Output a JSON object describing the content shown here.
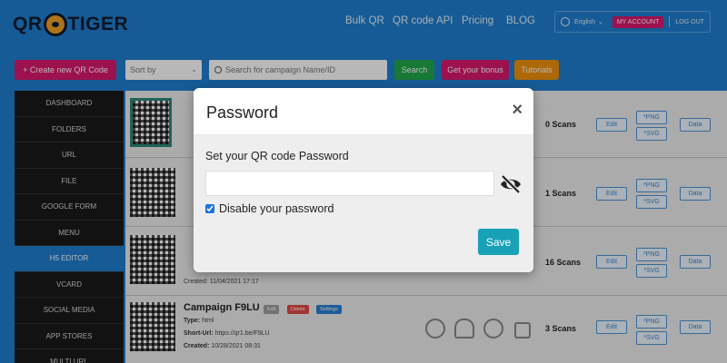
{
  "brand": {
    "logo_left": "QR",
    "logo_right": "TIGER"
  },
  "nav": {
    "bulk_qr": "Bulk QR",
    "qr_api": "QR code API",
    "pricing": "Pricing",
    "blog": "BLOG"
  },
  "account": {
    "language": "English",
    "my_account": "MY ACCOUNT",
    "logout": "LOG OUT"
  },
  "toolbar": {
    "create_label": "+ Create new QR Code",
    "sort_placeholder": "Sort by",
    "search_placeholder": "Search for campaign Name/ID",
    "search_label": "Search",
    "bonus_label": "Get your bonus",
    "tutorials_label": "Tutorials"
  },
  "sidebar": {
    "items": [
      {
        "label": "DASHBOARD"
      },
      {
        "label": "FOLDERS"
      },
      {
        "label": "URL"
      },
      {
        "label": "FILE"
      },
      {
        "label": "GOOGLE FORM"
      },
      {
        "label": "MENU"
      },
      {
        "label": "H5 EDITOR"
      },
      {
        "label": "VCARD"
      },
      {
        "label": "SOCIAL MEDIA"
      },
      {
        "label": "APP STORES"
      },
      {
        "label": "MULTI URL"
      }
    ]
  },
  "rows": [
    {
      "scans": "0 Scans"
    },
    {
      "scans": "1 Scans"
    },
    {
      "scans": "16 Scans",
      "created": "11/04/2021 17:17"
    },
    {
      "title": "Campaign F9LU",
      "type_label": "Type:",
      "type": "html",
      "short_label": "Short-Url:",
      "short_url": "https://qr1.be/F9LU",
      "created_label": "Created:",
      "created": "10/28/2021 08:31",
      "scans": "3 Scans",
      "tag_edit": "Edit",
      "tag_delete": "Delete",
      "tag_settings": "Settings"
    }
  ],
  "row_buttons": {
    "edit": "Edit",
    "png": "*PNG",
    "svg": "*SVG",
    "data": "Data"
  },
  "modal": {
    "title": "Password",
    "close": "×",
    "label": "Set your QR code Password",
    "password_value": "",
    "disable_label": "Disable your password",
    "disable_checked": true,
    "save_label": "Save"
  },
  "colors": {
    "header_bg": "#1f7fd0",
    "create_btn": "#d8186c",
    "search_btn": "#22a84a",
    "bonus_btn": "#d8186c",
    "tutorials_btn": "#f0900c",
    "active_sidebar": "#1f7fd0",
    "save_btn": "#17a2b8"
  }
}
